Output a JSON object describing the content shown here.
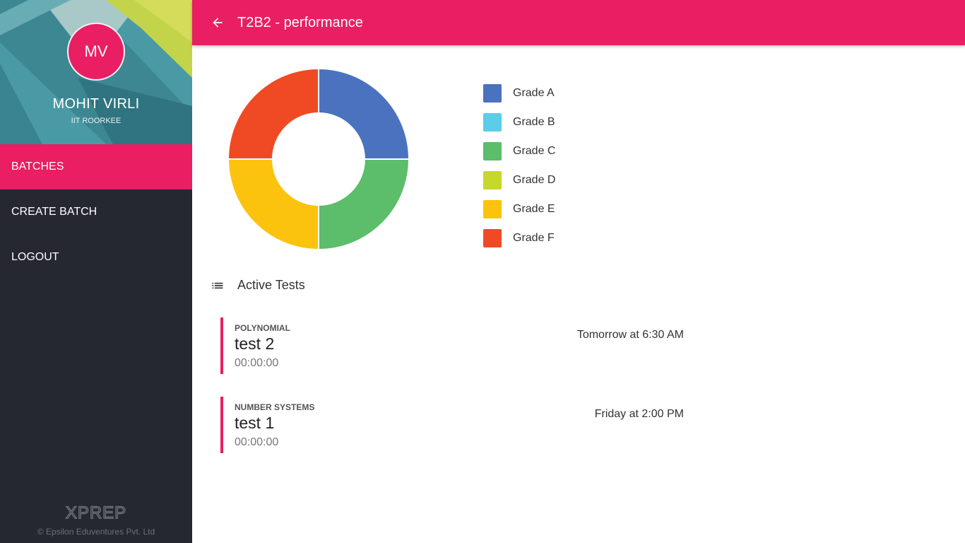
{
  "profile": {
    "initials": "MV",
    "name": "MOHIT VIRLI",
    "institute": "IIT ROORKEE"
  },
  "nav": {
    "items": [
      {
        "label": "BATCHES",
        "active": true
      },
      {
        "label": "CREATE BATCH",
        "active": false
      },
      {
        "label": "LOGOUT",
        "active": false
      }
    ]
  },
  "footer": {
    "logo": "XPREP",
    "copyright": "© Epsilon Eduventures Pvt. Ltd"
  },
  "header": {
    "title": "T2B2 - performance",
    "back_icon": "arrow-back-icon"
  },
  "chart_data": {
    "type": "pie",
    "categories": [
      "Grade A",
      "Grade B",
      "Grade C",
      "Grade D",
      "Grade E",
      "Grade F"
    ],
    "values": [
      1,
      0,
      1,
      0,
      1,
      1
    ],
    "colors": [
      "#4a72bf",
      "#5bcde8",
      "#5cbd6a",
      "#c6d82b",
      "#fcc30e",
      "#f04a24"
    ],
    "legend_position": "right"
  },
  "active_tests": {
    "title": "Active Tests",
    "icon": "list-icon",
    "items": [
      {
        "subject": "POLYNOMIAL",
        "name": "test 2",
        "time": "00:00:00",
        "when": "Tomorrow at 6:30 AM"
      },
      {
        "subject": "NUMBER SYSTEMS",
        "name": "test 1",
        "time": "00:00:00",
        "when": "Friday at 2:00 PM"
      }
    ]
  },
  "colors": {
    "accent": "#e91e63",
    "sidebar": "#252731"
  }
}
